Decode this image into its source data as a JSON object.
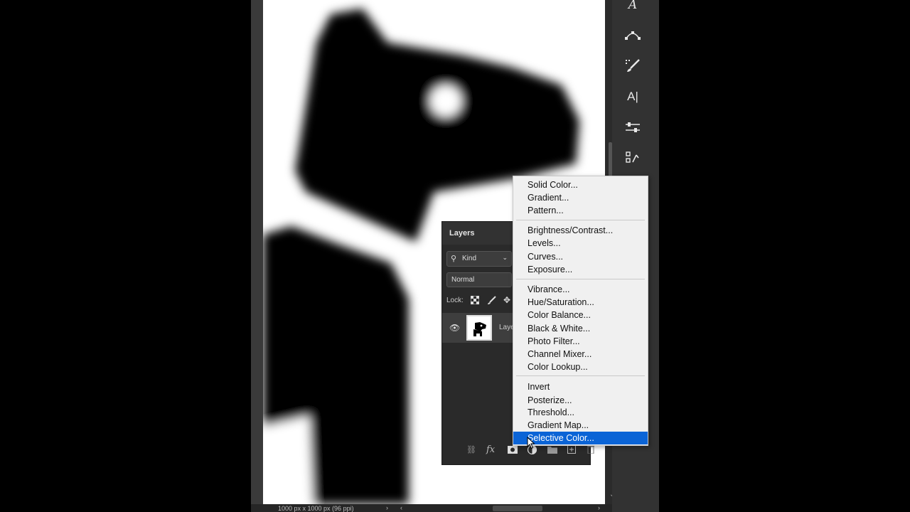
{
  "status_bar": {
    "document_size": "1000 px x 1000 px (96 ppi)"
  },
  "toolstrip": {
    "icons": [
      "type-path-icon",
      "pen-path-icon",
      "brush-settings-icon",
      "character-icon",
      "adjust-sliders-icon",
      "history-icon"
    ]
  },
  "layers_panel": {
    "title": "Layers",
    "filter_label": "Kind",
    "blend_mode": "Normal",
    "lock_label": "Lock:",
    "layer_name": "Laye"
  },
  "adjustment_menu": {
    "groups": [
      [
        "Solid Color...",
        "Gradient...",
        "Pattern..."
      ],
      [
        "Brightness/Contrast...",
        "Levels...",
        "Curves...",
        "Exposure..."
      ],
      [
        "Vibrance...",
        "Hue/Saturation...",
        "Color Balance...",
        "Black & White...",
        "Photo Filter...",
        "Channel Mixer...",
        "Color Lookup..."
      ],
      [
        "Invert",
        "Posterize...",
        "Threshold...",
        "Gradient Map...",
        "Selective Color..."
      ]
    ],
    "selected": "Selective Color..."
  },
  "colors": {
    "menu_highlight": "#0b64d6",
    "panel_bg": "#2a2a2a",
    "menu_bg": "#f0f0f0"
  }
}
